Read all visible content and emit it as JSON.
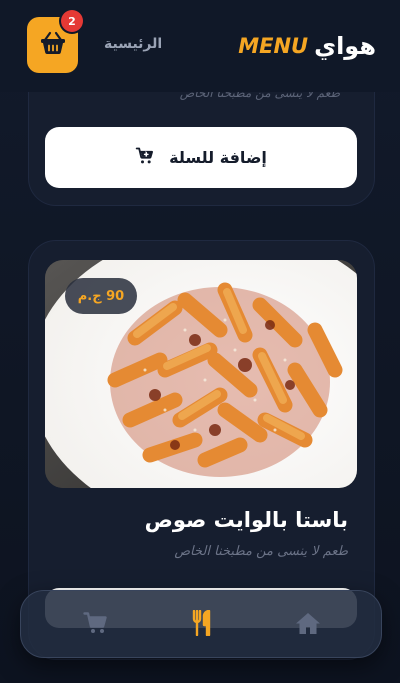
{
  "header": {
    "brand_name": "هواي",
    "brand_menu": "MENU",
    "home_label": "الرئيسية",
    "cart_count": "2",
    "cart_icon": "basket-icon",
    "accent_color": "#f5a623"
  },
  "cards": [
    {
      "description_partial": "طعم لا ينسى من مطبخنا الخاص",
      "add_button_label": "إضافة للسلة",
      "add_button_icon": "cart-plus-icon"
    },
    {
      "title": "باستا بالوايت صوص",
      "description": "طعم لا ينسى من مطبخنا الخاص",
      "price": "90 ج.م",
      "image": "penne-pasta-plate"
    }
  ],
  "bottom_nav": {
    "items": [
      {
        "icon": "cart-icon",
        "active": false
      },
      {
        "icon": "fork-knife-icon",
        "active": true
      },
      {
        "icon": "home-icon",
        "active": false
      }
    ],
    "active_color": "#f5a623",
    "inactive_color": "#6b7387"
  }
}
